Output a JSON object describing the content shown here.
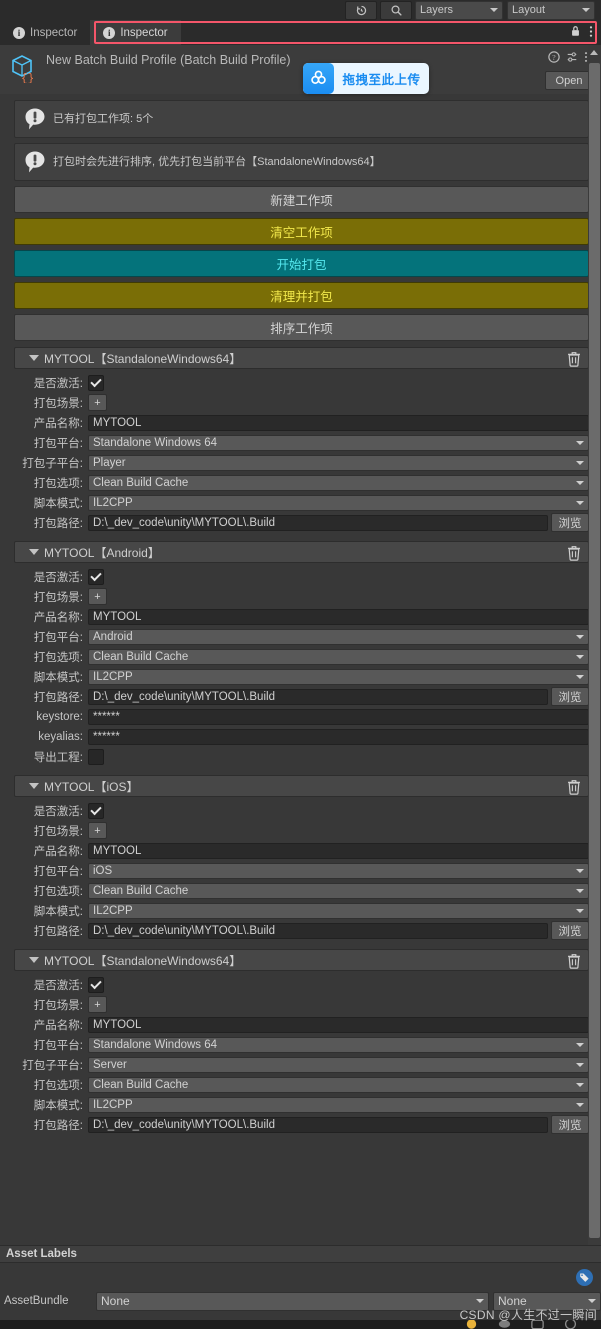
{
  "toolbar": {
    "history_icon": "history-icon",
    "search_icon": "search-icon",
    "layers_label": "Layers",
    "layout_label": "Layout"
  },
  "tabs": [
    {
      "label": "Inspector",
      "icon": "info-icon",
      "active": false
    },
    {
      "label": "Inspector",
      "icon": "info-icon",
      "active": true
    }
  ],
  "tabbar_right": {
    "lock_icon": "lock-icon",
    "menu_icon": "kebab-menu-icon"
  },
  "object_header": {
    "icon": "script-asset-icon",
    "title": "New Batch Build Profile (Batch Build Profile)",
    "help_icon": "help-icon",
    "preset_icon": "preset-icon",
    "menu_icon": "kebab-menu-icon",
    "open_label": "Open"
  },
  "drag_upload_overlay": {
    "icon": "cloud-upload-icon",
    "label": "拖拽至此上传"
  },
  "help_boxes": [
    {
      "icon": "info-bubble-icon",
      "text": "已有打包工作项: 5个"
    },
    {
      "icon": "info-bubble-icon",
      "text": "打包时会先进行排序, 优先打包当前平台【StandaloneWindows64】"
    }
  ],
  "action_buttons": [
    {
      "label": "新建工作项",
      "style": "grey"
    },
    {
      "label": "清空工作项",
      "style": "olive"
    },
    {
      "label": "开始打包",
      "style": "teal"
    },
    {
      "label": "清理并打包",
      "style": "olive"
    },
    {
      "label": "排序工作项",
      "style": "grey"
    }
  ],
  "field_labels": {
    "active": "是否激活:",
    "scenes": "打包场景:",
    "product_name": "产品名称:",
    "platform": "打包平台:",
    "subtarget": "打包子平台:",
    "build_options": "打包选项:",
    "script_mode": "脚本模式:",
    "build_path": "打包路径:",
    "keystore": "keystore:",
    "keyalias": "keyalias:",
    "export_project": "导出工程:"
  },
  "common": {
    "browse_label": "浏览",
    "plus_label": "+",
    "delete_icon": "trash-icon",
    "foldout_icon": "triangle-down-icon"
  },
  "sections": [
    {
      "title": "MYTOOL【StandaloneWindows64】",
      "active": true,
      "product_name": "MYTOOL",
      "platform": "Standalone Windows 64",
      "subtarget": "Player",
      "has_subtarget": true,
      "build_options": "Clean Build Cache",
      "script_mode": "IL2CPP",
      "build_path": "D:\\_dev_code\\unity\\MYTOOL\\.Build",
      "has_android": false
    },
    {
      "title": "MYTOOL【Android】",
      "active": true,
      "product_name": "MYTOOL",
      "platform": "Android",
      "subtarget": "",
      "has_subtarget": false,
      "build_options": "Clean Build Cache",
      "script_mode": "IL2CPP",
      "build_path": "D:\\_dev_code\\unity\\MYTOOL\\.Build",
      "has_android": true,
      "keystore": "******",
      "keyalias": "******",
      "export_project": false
    },
    {
      "title": "MYTOOL【iOS】",
      "active": true,
      "product_name": "MYTOOL",
      "platform": "iOS",
      "subtarget": "",
      "has_subtarget": false,
      "build_options": "Clean Build Cache",
      "script_mode": "IL2CPP",
      "build_path": "D:\\_dev_code\\unity\\MYTOOL\\.Build",
      "has_android": false
    },
    {
      "title": "MYTOOL【StandaloneWindows64】",
      "active": true,
      "product_name": "MYTOOL",
      "platform": "Standalone Windows 64",
      "subtarget": "Server",
      "has_subtarget": true,
      "build_options": "Clean Build Cache",
      "script_mode": "IL2CPP",
      "build_path": "D:\\_dev_code\\unity\\MYTOOL\\.Build",
      "has_android": false
    }
  ],
  "footer": {
    "asset_labels_title": "Asset Labels",
    "tag_icon": "label-tag-icon",
    "assetbundle_label": "AssetBundle",
    "assetbundle_value": "None",
    "assetbundle_variant": "None"
  },
  "watermark": "CSDN @人生不过一瞬间",
  "colors": {
    "panel_bg": "#383838",
    "toolbar_bg": "#2b2b2b",
    "accent_teal": "#04737b",
    "accent_teal_text": "#55e8ef",
    "accent_olive": "#7a6e06",
    "accent_olive_text": "#f2e84b",
    "annotation_red": "#f4566a",
    "upload_blue": "#1a8cf0"
  }
}
